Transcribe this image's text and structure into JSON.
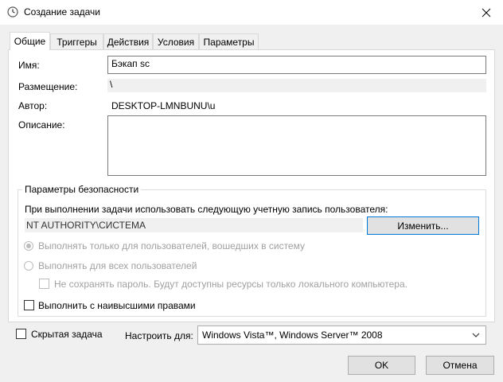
{
  "window": {
    "title": "Создание задачи",
    "title_icon": "clock-icon",
    "close_icon": "close-icon"
  },
  "tabs": [
    {
      "label": "Общие",
      "active": true
    },
    {
      "label": "Триггеры"
    },
    {
      "label": "Действия"
    },
    {
      "label": "Условия"
    },
    {
      "label": "Параметры"
    }
  ],
  "general": {
    "name_label": "Имя:",
    "name_value": "Бэкап sc",
    "location_label": "Размещение:",
    "location_value": "\\",
    "author_label": "Автор:",
    "author_value": "DESKTOP-LMNBUNU\\u",
    "description_label": "Описание:",
    "description_value": ""
  },
  "security": {
    "group_title": "Параметры безопасности",
    "account_prompt": "При выполнении задачи использовать следующую учетную запись пользователя:",
    "account_value": "NT AUTHORITY\\СИСТЕМА",
    "change_button": "Изменить...",
    "radio_logged_on": "Выполнять только для пользователей, вошедших в систему",
    "radio_all_users": "Выполнять для всех пользователей",
    "no_store_password": "Не сохранять пароль. Будут доступны ресурсы только локального компьютера.",
    "highest_privileges": "Выполнить с наивысшими правами"
  },
  "footer": {
    "hidden_task": "Скрытая задача",
    "configure_for_label": "Настроить для:",
    "configure_for_value": "Windows Vista™, Windows Server™ 2008",
    "ok_button": "OK",
    "cancel_button": "Отмена"
  }
}
